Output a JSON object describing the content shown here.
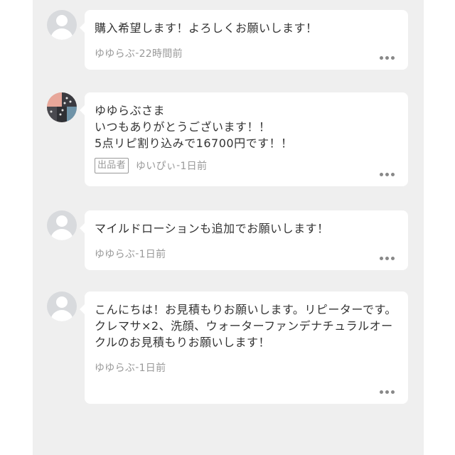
{
  "comments": [
    {
      "text": "購入希望します！よろしくお願いします！",
      "author": "ゆゆらぶ",
      "time": "22時間前",
      "avatar": "default-avatar-icon"
    },
    {
      "text": "ゆゆらぶさま\nいつもありがとうございます！！\n5点リピ割り込みで16700円です！！",
      "badge": "出品者",
      "author": "ゆいぴぃ",
      "time": "1日前",
      "avatar": "seller-photo"
    },
    {
      "text": "マイルドローションも追加でお願いします！",
      "author": "ゆゆらぶ",
      "time": "1日前",
      "avatar": "default-avatar-icon"
    },
    {
      "text": "こんにちは！お見積もりお願いします。リピーターです。\nクレマサ×2、洗顔、ウォーターファンデナチュラルオークルのお見積もりお願いします！",
      "author": "ゆゆらぶ",
      "time": "1日前",
      "avatar": "default-avatar-icon"
    }
  ],
  "separator": " - "
}
